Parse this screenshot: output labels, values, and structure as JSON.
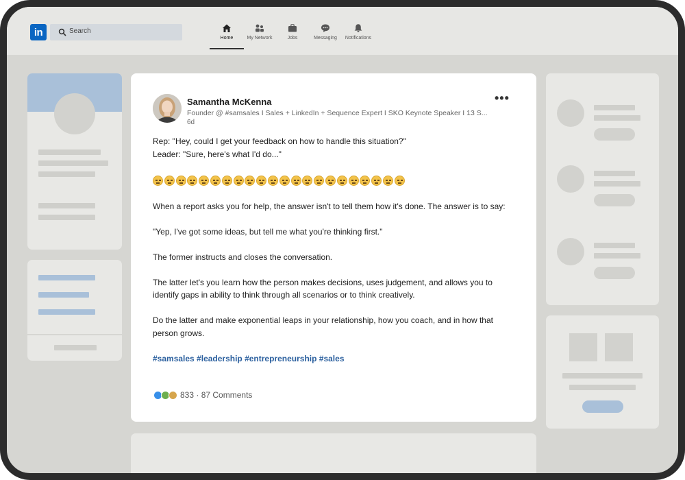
{
  "nav": {
    "logo": "in",
    "search_placeholder": "Search",
    "items": [
      {
        "label": "Home",
        "icon": "home-icon",
        "active": true
      },
      {
        "label": "My Network",
        "icon": "network-icon",
        "active": false
      },
      {
        "label": "Jobs",
        "icon": "briefcase-icon",
        "active": false
      },
      {
        "label": "Messaging",
        "icon": "chat-icon",
        "active": false
      },
      {
        "label": "Notifications",
        "icon": "bell-icon",
        "active": false
      }
    ]
  },
  "post": {
    "author": "Samantha McKenna",
    "headline": "Founder @ #samsales I Sales + LinkedIn + Sequence Expert I SKO Keynote Speaker I 13 S...",
    "time": "6d",
    "more": "•••",
    "line1": "Rep: \"Hey, could I get your feedback on how to handle this situation?\"",
    "line2": "Leader: \"Sure, here's what I'd do...\"",
    "emoji_name": "expressionless-face-icon",
    "emoji_count": 22,
    "para1": "When a report asks you for help, the answer isn't to tell them how it's done.   The answer is to say:",
    "para2": "\"Yep, I've got some ideas, but tell me what you're thinking first.\"",
    "para3": "The former instructs and closes the conversation.",
    "para4": "The latter let's you learn how the person makes decisions, uses judgement, and allows you to identify gaps in ability to think through all scenarios or to think creatively.",
    "para5": "Do the latter and make exponential leaps in your relationship, how you coach, and in how that person grows.",
    "hashtags": "#samsales #leadership #entrepreneurship #sales",
    "reactions_count": "833",
    "comments": "87 Comments"
  },
  "colors": {
    "brand": "#0a66c2",
    "hashtag": "#2a5f9e",
    "background": "#d6d6d2"
  }
}
